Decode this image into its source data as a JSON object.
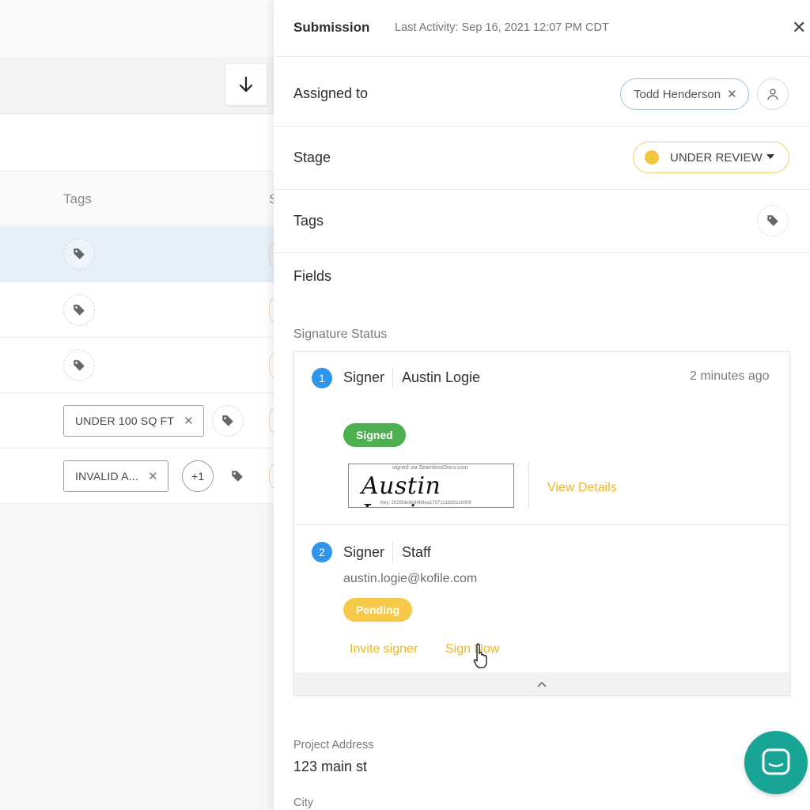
{
  "list": {
    "tags_header": "Tags",
    "clipped_header_char": "S",
    "rows": [
      {
        "chips": [],
        "selected": true
      },
      {
        "chips": []
      },
      {
        "chips": []
      },
      {
        "chips": [
          "UNDER 100 SQ FT"
        ]
      },
      {
        "chips": [
          "INVALID A..."
        ],
        "more": "+1"
      }
    ]
  },
  "panel": {
    "title": "Submission",
    "last_activity": "Last Activity: Sep 16, 2021 12:07 PM CDT",
    "assigned_label": "Assigned to",
    "assignee": "Todd Henderson",
    "stage_label": "Stage",
    "stage_value": "UNDER REVIEW",
    "stage_color": "#f3c63f",
    "tags_label": "Tags",
    "fields_label": "Fields",
    "signature_status_label": "Signature Status",
    "signers": [
      {
        "number": "1",
        "role": "Signer",
        "name": "Austin Logie",
        "time": "2 minutes ago",
        "status": "Signed",
        "status_color": "#4caf50",
        "signature_caption": "signed via SeamlessDocs.com",
        "signature_name": "Austin Logie",
        "signature_key": "Key: 2026fde8e34b9ea17071c18d01cb008",
        "view_details": "View Details"
      },
      {
        "number": "2",
        "role": "Signer",
        "name": "Staff",
        "email": "austin.logie@kofile.com",
        "status": "Pending",
        "status_color": "#f7c948",
        "invite": "Invite signer",
        "sign_now": "Sign Now"
      }
    ],
    "project_address_label": "Project Address",
    "project_address_value": "123 main st",
    "city_label": "City"
  },
  "accent_color": "#f0b429"
}
